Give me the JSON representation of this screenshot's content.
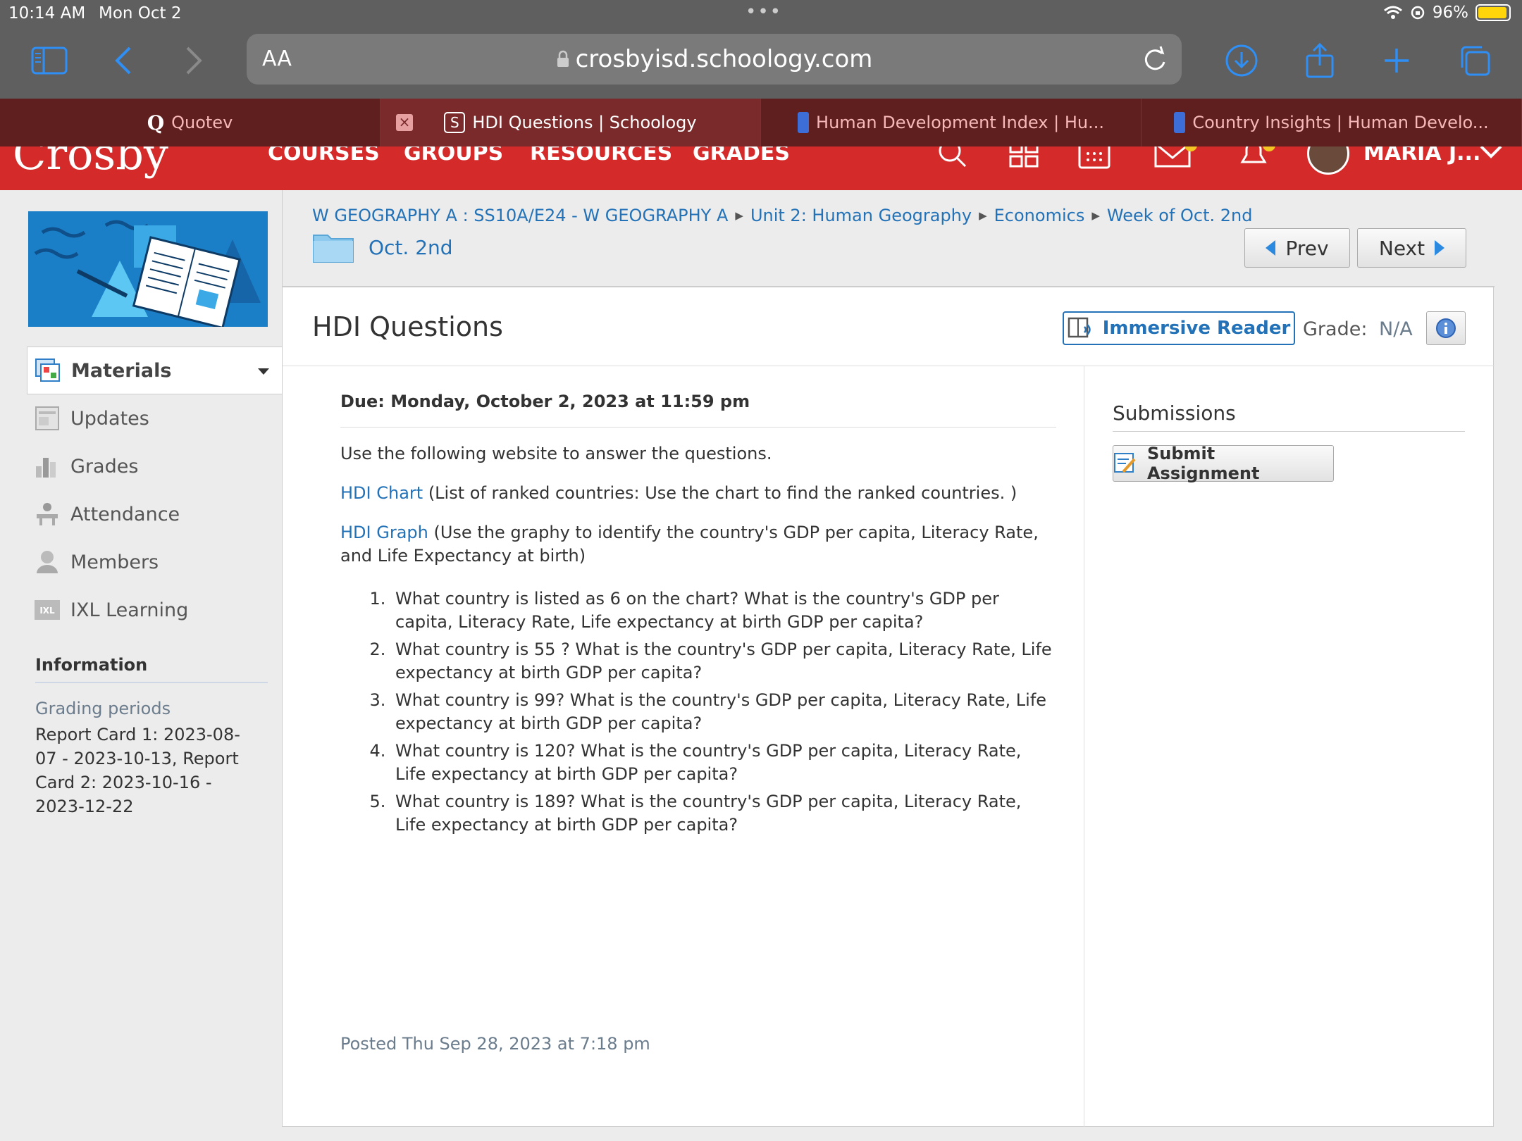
{
  "status_bar": {
    "time": "10:14 AM",
    "date": "Mon Oct 2",
    "battery": "96%",
    "battery_level": 0.96
  },
  "browser": {
    "aa_label": "AA",
    "url": "crosbyisd.schoology.com",
    "tabs": [
      {
        "label": "Quotev",
        "favicon": "Q"
      },
      {
        "label": "HDI Questions | Schoology",
        "favicon": "S"
      },
      {
        "label": "Human Development Index | Hu...",
        "favicon": "un-icon"
      },
      {
        "label": "Country Insights | Human Develo...",
        "favicon": "un-icon"
      }
    ]
  },
  "site_header": {
    "logo": "Crosby",
    "nav": [
      "COURSES",
      "GROUPS",
      "RESOURCES",
      "GRADES"
    ],
    "user_name": "MARIA J..."
  },
  "sidebar": {
    "menu": [
      {
        "label": "Materials",
        "icon": "materials-icon"
      },
      {
        "label": "Updates",
        "icon": "updates-icon"
      },
      {
        "label": "Grades",
        "icon": "grades-icon"
      },
      {
        "label": "Attendance",
        "icon": "attendance-icon"
      },
      {
        "label": "Members",
        "icon": "members-icon"
      },
      {
        "label": "IXL Learning",
        "icon": "ixl-icon"
      }
    ],
    "info_heading": "Information",
    "grading_label": "Grading periods",
    "grading_text": "Report Card 1: 2023-08-07 - 2023-10-13, Report Card 2: 2023-10-16 - 2023-12-22"
  },
  "breadcrumb": {
    "items": [
      "W GEOGRAPHY A : SS10A/E24 - W GEOGRAPHY A",
      "Unit 2: Human Geography",
      "Economics",
      "Week of Oct. 2nd"
    ],
    "folder": "Oct. 2nd"
  },
  "pager": {
    "prev": "Prev",
    "next": "Next"
  },
  "assignment": {
    "title": "HDI Questions",
    "immersive_reader": "Immersive Reader",
    "grade_label": "Grade:",
    "grade_value": "N/A",
    "due": "Due: Monday, October 2, 2023 at 11:59 pm",
    "intro": "Use the following website to answer the questions.",
    "chart_link": "HDI Chart",
    "chart_desc": " (List of ranked countries: Use the chart to find the ranked countries. )",
    "graph_link": "HDI Graph",
    "graph_desc": " (Use the graphy to identify the country's GDP per capita, Literacy Rate, and Life Expectancy at birth)",
    "questions": [
      "What country is listed as 6 on the chart? What is the country's GDP per capita, Literacy Rate, Life expectancy at birth GDP per capita?",
      "What country is 55 ? What is the country's GDP per capita, Literacy Rate, Life expectancy at birth GDP per capita?",
      "What country is 99? What is the country's GDP per capita, Literacy Rate, Life expectancy at birth GDP per capita?",
      "What country is 120? What is the country's GDP per capita, Literacy Rate, Life expectancy at birth GDP per capita?",
      "What country is 189? What is the country's GDP per capita, Literacy Rate, Life expectancy at birth GDP per capita?"
    ],
    "posted": "Posted Thu Sep 28, 2023 at 7:18 pm"
  },
  "submissions": {
    "heading": "Submissions",
    "submit_label": "Submit Assignment"
  },
  "colors": {
    "brand_red": "#d42a2a",
    "link_blue": "#2372b7",
    "chrome_gray": "#5f5f5f"
  }
}
